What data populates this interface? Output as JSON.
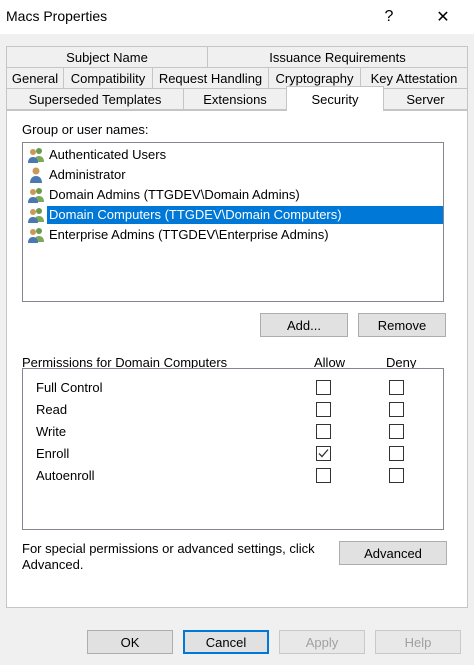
{
  "window": {
    "title": "Macs Properties",
    "help_glyph": "?",
    "close_glyph": "✕"
  },
  "tabs": {
    "row1": [
      "Subject Name",
      "Issuance Requirements"
    ],
    "row2": [
      "General",
      "Compatibility",
      "Request Handling",
      "Cryptography",
      "Key Attestation"
    ],
    "row3": [
      "Superseded Templates",
      "Extensions",
      "Security",
      "Server"
    ],
    "active": "Security"
  },
  "security": {
    "group_label": "Group or user names:",
    "users": [
      {
        "name": "Authenticated Users",
        "icon": "group-icon",
        "selected": false
      },
      {
        "name": "Administrator",
        "icon": "user-icon",
        "selected": false
      },
      {
        "name": "Domain Admins (TTGDEV\\Domain Admins)",
        "icon": "group-icon",
        "selected": false
      },
      {
        "name": "Domain Computers (TTGDEV\\Domain Computers)",
        "icon": "group-icon",
        "selected": true
      },
      {
        "name": "Enterprise Admins (TTGDEV\\Enterprise Admins)",
        "icon": "group-icon",
        "selected": false
      }
    ],
    "add_label": "Add...",
    "remove_label": "Remove",
    "permissions_label": "Permissions for Domain Computers",
    "allow_header": "Allow",
    "deny_header": "Deny",
    "permissions": [
      {
        "name": "Full Control",
        "allow": false,
        "deny": false
      },
      {
        "name": "Read",
        "allow": false,
        "deny": false
      },
      {
        "name": "Write",
        "allow": false,
        "deny": false
      },
      {
        "name": "Enroll",
        "allow": true,
        "deny": false
      },
      {
        "name": "Autoenroll",
        "allow": false,
        "deny": false
      }
    ],
    "advanced_text_1": "For special permissions or advanced settings, click",
    "advanced_text_2": "Advanced.",
    "advanced_label": "Advanced"
  },
  "footer": {
    "ok_label": "OK",
    "cancel_label": "Cancel",
    "apply_label": "Apply",
    "help_label": "Help"
  },
  "colors": {
    "selection": "#0078d7",
    "dialog_bg": "#f0f0f0"
  }
}
